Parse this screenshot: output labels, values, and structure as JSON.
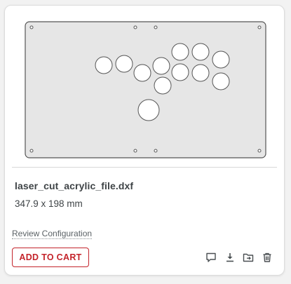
{
  "card": {
    "file_name": "laser_cut_acrylic_file.dxf",
    "dimensions": "347.9 x 198 mm",
    "review_link": "Review Configuration",
    "add_to_cart_label": "ADD TO CART"
  },
  "colors": {
    "accent": "#c4242b",
    "panel_fill": "#e6e6e6",
    "outline": "#555555",
    "icon": "#4a4f52"
  },
  "actions": [
    {
      "icon": "comment-icon"
    },
    {
      "icon": "download-icon"
    },
    {
      "icon": "folder-move-icon"
    },
    {
      "icon": "trash-icon"
    }
  ]
}
